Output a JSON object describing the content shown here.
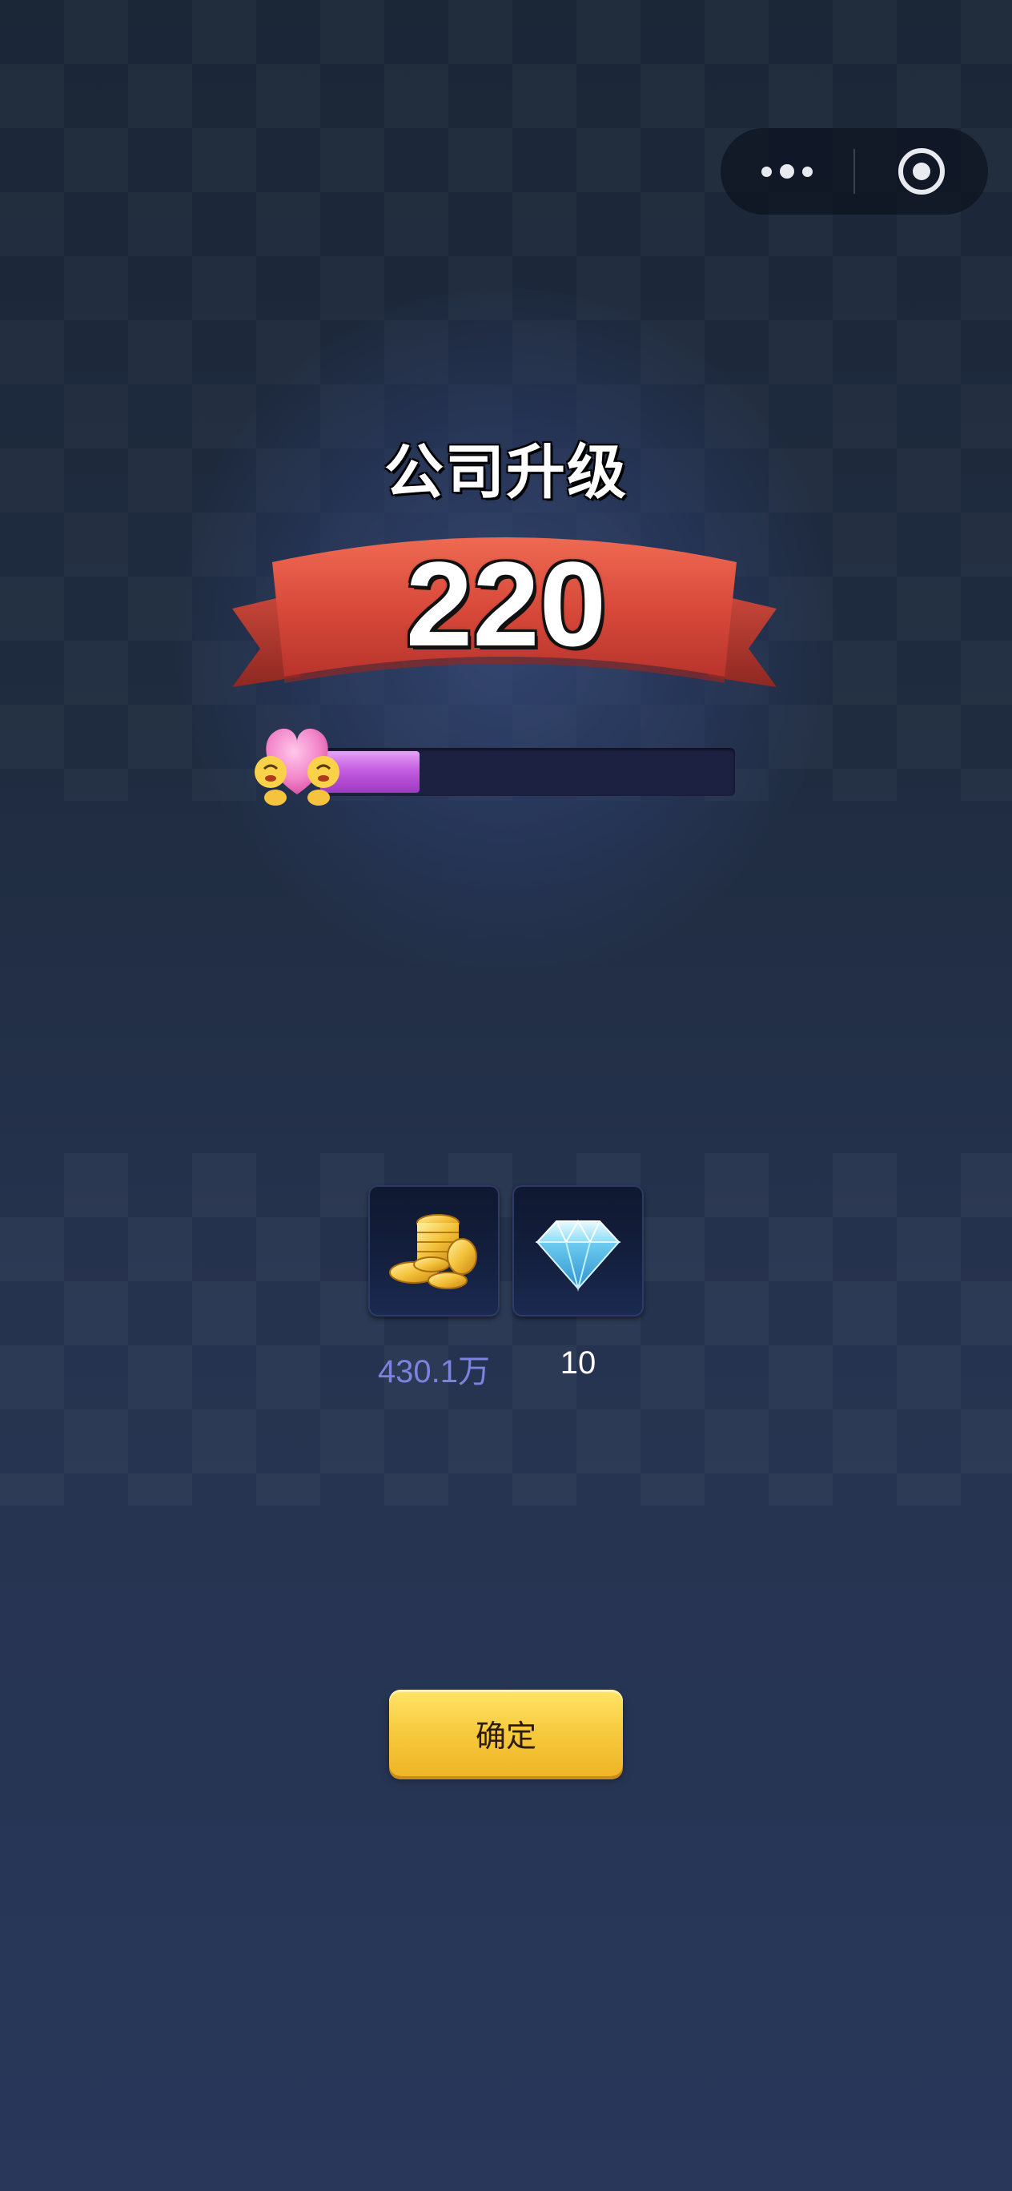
{
  "title": "公司升级",
  "level": "220",
  "progress": {
    "fraction": 0.24
  },
  "rewards": [
    {
      "icon": "gold-coins-icon",
      "amount": "430.1万",
      "color": "#7b82e0"
    },
    {
      "icon": "diamond-icon",
      "amount": "10",
      "color": "#ffffff"
    }
  ],
  "confirm_label": "确定",
  "colors": {
    "ribbon": "#d94a3b",
    "progress_fill": "#c35de0",
    "button": "#f6c93c"
  }
}
